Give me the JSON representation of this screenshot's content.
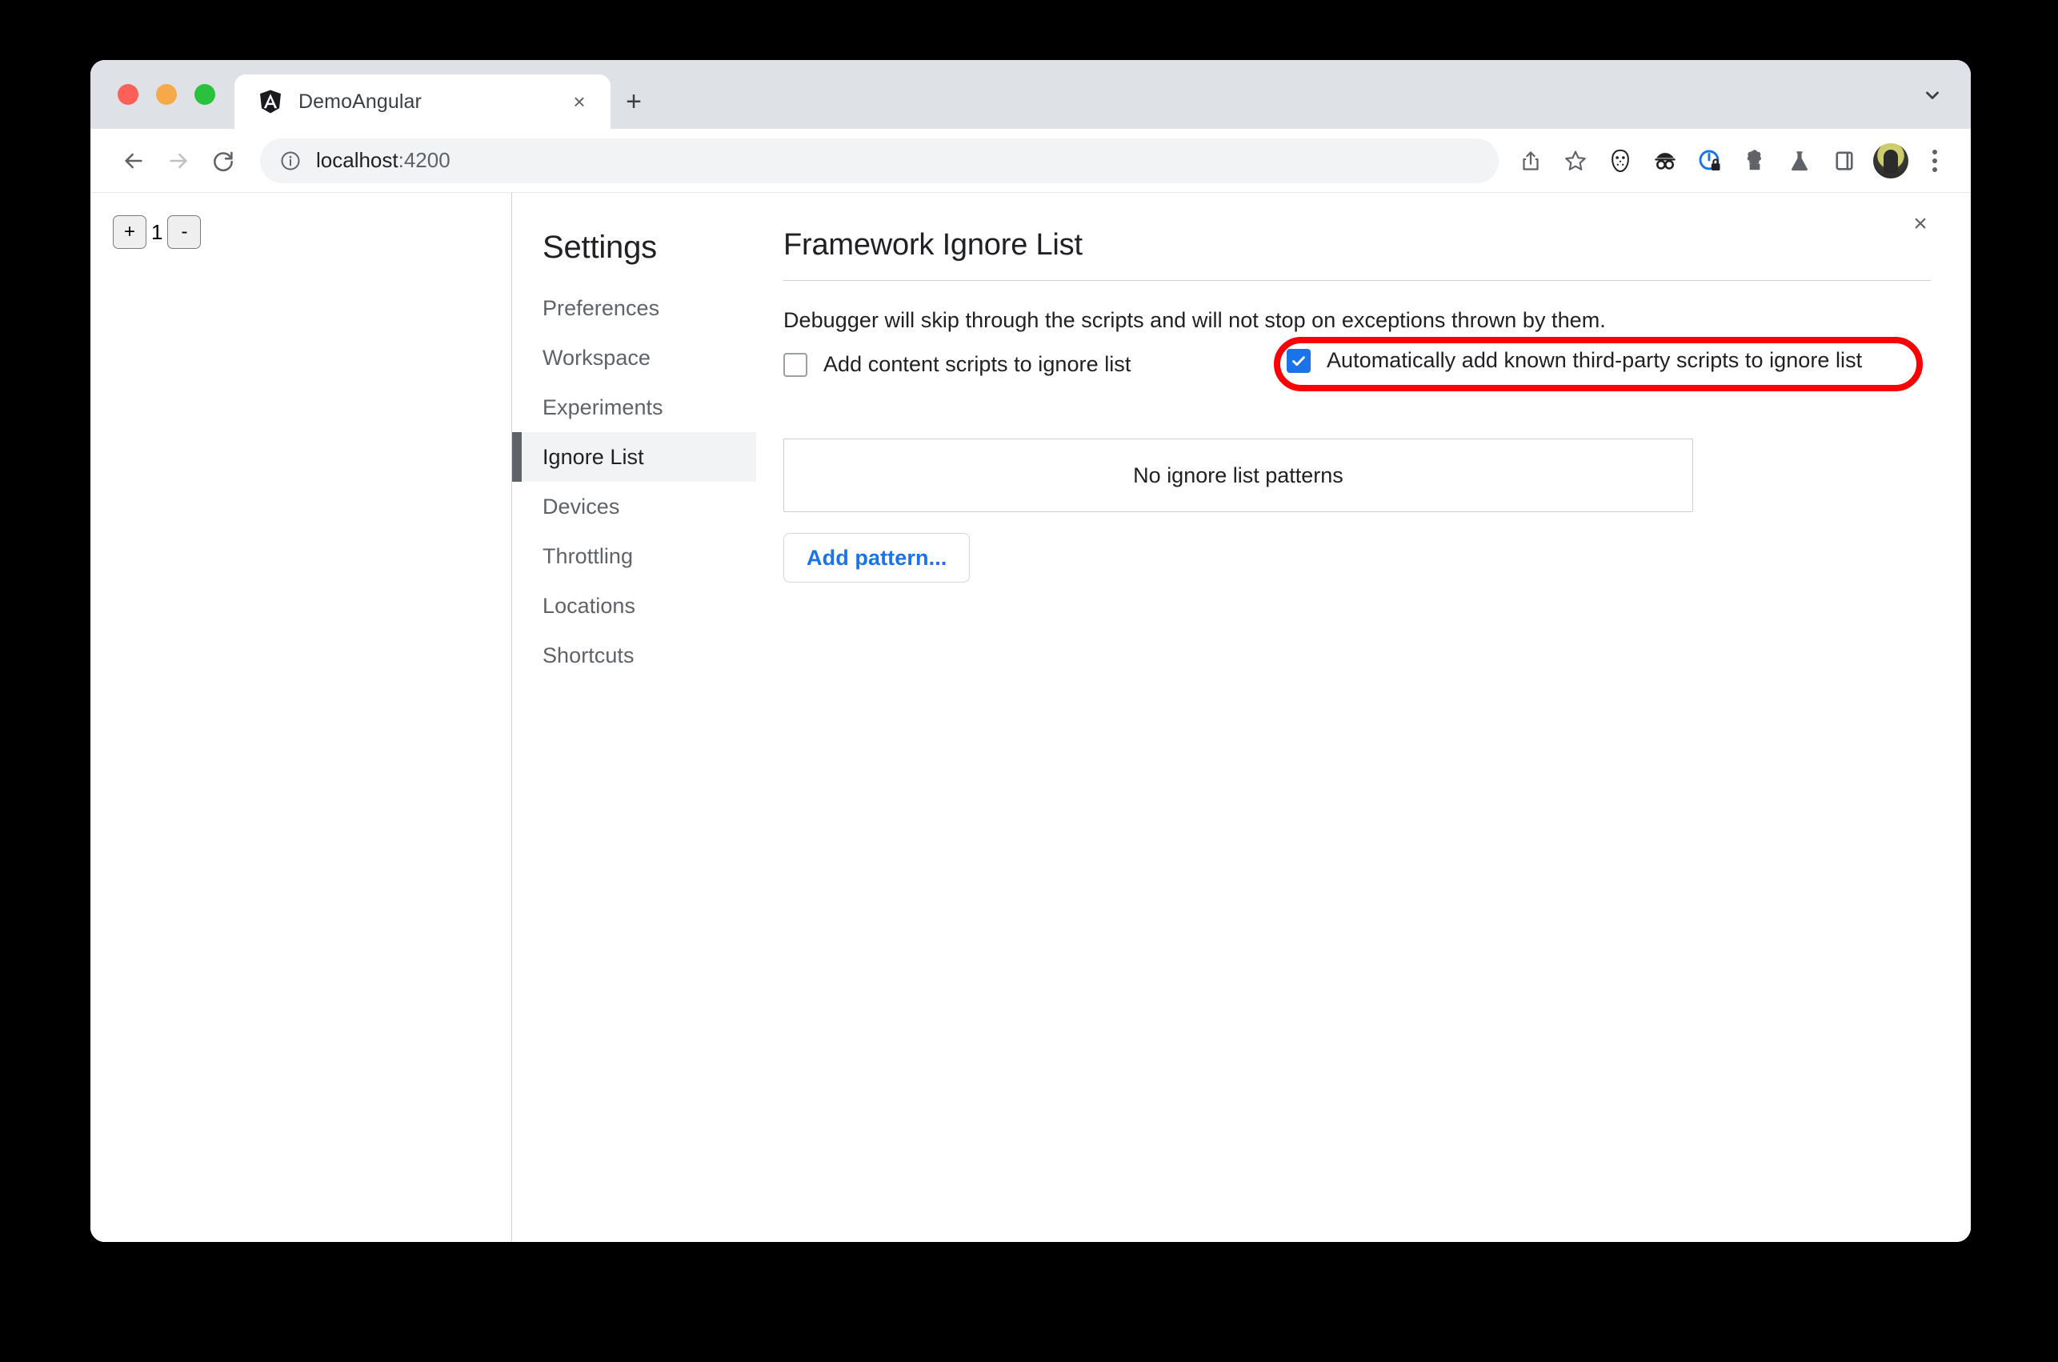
{
  "browser": {
    "traffic_lights": [
      "close",
      "minimize",
      "maximize"
    ],
    "tab": {
      "title": "DemoAngular",
      "favicon_name": "angular-logo-icon",
      "close_label": "×"
    },
    "new_tab_label": "+",
    "tab_list_icon": "chevron-down-icon",
    "nav": {
      "back_icon": "arrow-left-icon",
      "forward_icon": "arrow-right-icon",
      "reload_icon": "reload-icon"
    },
    "omnibox": {
      "site_info_icon": "info-circle-icon",
      "url_host": "localhost",
      "url_port": ":4200",
      "url_full": "localhost:4200"
    },
    "toolbar_icons": [
      "share-icon",
      "bookmark-star-icon",
      "hockey-mask-extension-icon",
      "goggles-extension-icon",
      "privacy-lock-extension-icon",
      "puzzle-extensions-icon",
      "flask-experiments-icon",
      "side-panel-icon"
    ],
    "avatar_name": "user-avatar",
    "menu_icon": "kebab-menu-icon"
  },
  "page": {
    "counter": {
      "increment_label": "+",
      "value": "1",
      "decrement_label": "-"
    }
  },
  "devtools": {
    "close_icon": "close-icon",
    "close_label": "×",
    "settings": {
      "heading": "Settings",
      "nav_items": [
        {
          "label": "Preferences",
          "selected": false
        },
        {
          "label": "Workspace",
          "selected": false
        },
        {
          "label": "Experiments",
          "selected": false
        },
        {
          "label": "Ignore List",
          "selected": true
        },
        {
          "label": "Devices",
          "selected": false
        },
        {
          "label": "Throttling",
          "selected": false
        },
        {
          "label": "Locations",
          "selected": false
        },
        {
          "label": "Shortcuts",
          "selected": false
        }
      ],
      "panel": {
        "title": "Framework Ignore List",
        "description": "Debugger will skip through the scripts and will not stop on exceptions thrown by them.",
        "checkboxes": [
          {
            "label": "Add content scripts to ignore list",
            "checked": false
          },
          {
            "label": "Automatically add known third-party scripts to ignore list",
            "checked": true,
            "highlighted": true
          }
        ],
        "empty_patterns_text": "No ignore list patterns",
        "add_pattern_label": "Add pattern..."
      }
    }
  },
  "colors": {
    "accent_blue": "#1a73e8",
    "annotation_red": "#fb0007",
    "tabstrip_gray": "#dee1e6",
    "omnibox_gray": "#f1f3f4",
    "selected_nav_bg": "#f1f3f4",
    "selected_nav_marker": "#5f6368"
  }
}
